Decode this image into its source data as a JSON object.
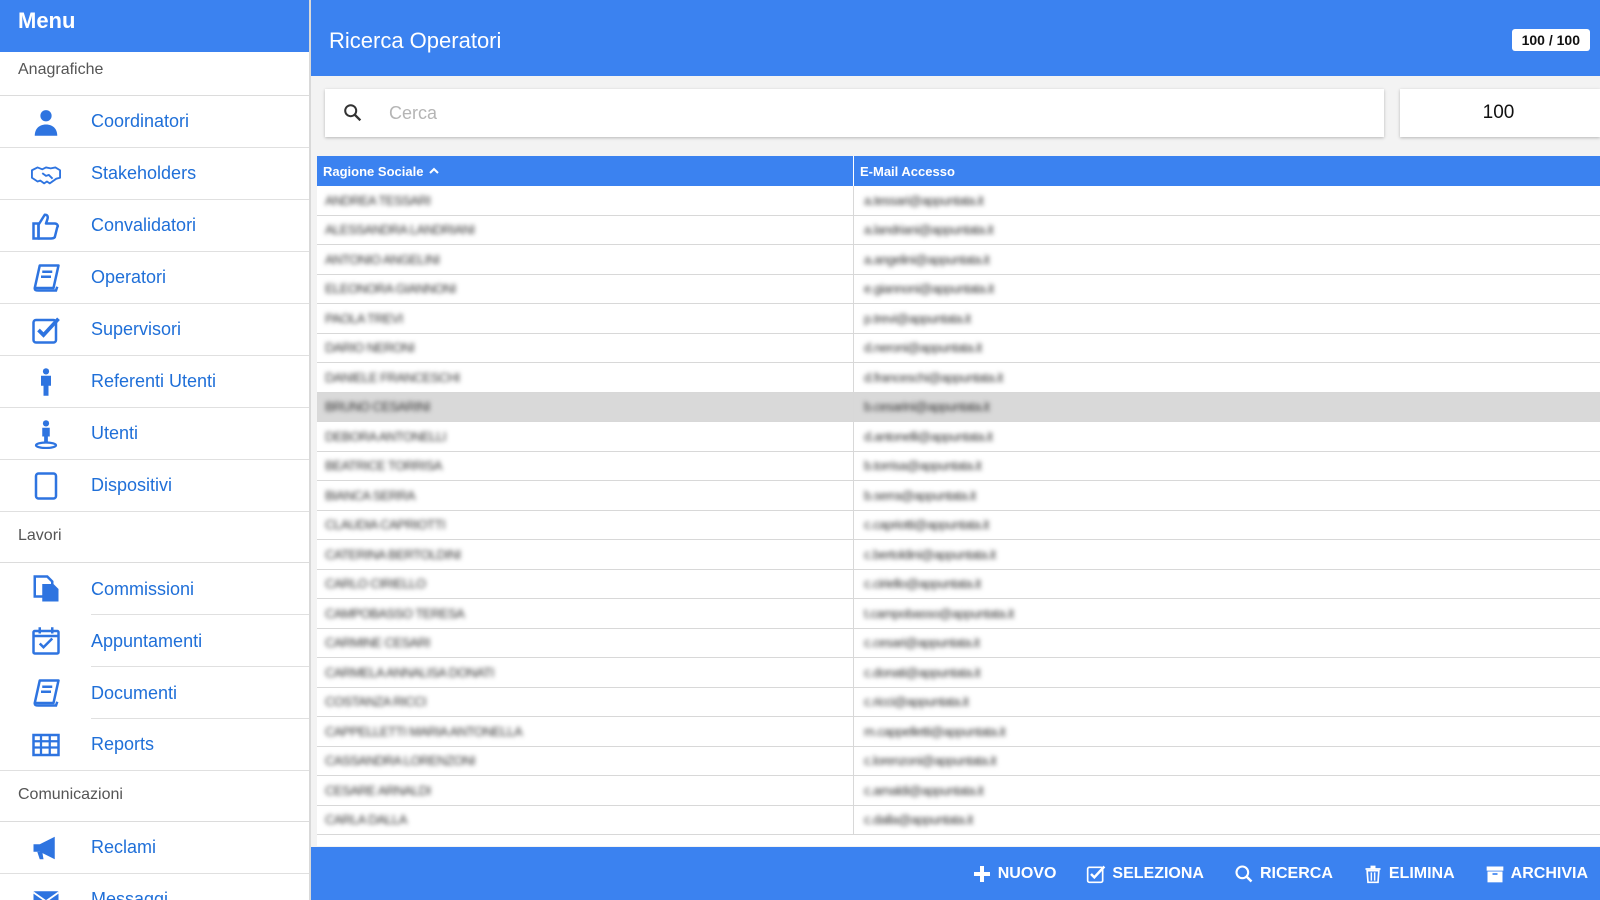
{
  "sidebar": {
    "title": "Menu",
    "sections": [
      {
        "title": "Anagrafiche",
        "items": [
          {
            "label": "Coordinatori",
            "icon": "user-icon"
          },
          {
            "label": "Stakeholders",
            "icon": "handshake-icon"
          },
          {
            "label": "Convalidatori",
            "icon": "thumbs-up-icon"
          },
          {
            "label": "Operatori",
            "icon": "book-icon"
          },
          {
            "label": "Supervisori",
            "icon": "check-square-icon"
          },
          {
            "label": "Referenti Utenti",
            "icon": "male-icon"
          },
          {
            "label": "Utenti",
            "icon": "street-view-icon"
          },
          {
            "label": "Dispositivi",
            "icon": "tablet-icon"
          }
        ]
      },
      {
        "title": "Lavori",
        "items": [
          {
            "label": "Commissioni",
            "icon": "files-icon"
          },
          {
            "label": "Appuntamenti",
            "icon": "calendar-check-icon"
          },
          {
            "label": "Documenti",
            "icon": "book-icon"
          },
          {
            "label": "Reports",
            "icon": "table-icon"
          }
        ]
      },
      {
        "title": "Comunicazioni",
        "items": [
          {
            "label": "Reclami",
            "icon": "megaphone-icon"
          },
          {
            "label": "Messaggi",
            "icon": "envelope-icon"
          }
        ]
      }
    ]
  },
  "header": {
    "title": "Ricerca Operatori",
    "counter": "100 / 100"
  },
  "search": {
    "placeholder": "Cerca",
    "value": "",
    "limit": "100"
  },
  "table": {
    "columns": [
      "Ragione Sociale",
      "E-Mail Accesso"
    ],
    "selected_row_index": 7,
    "rows": [
      [
        "ANDREA TESSARI",
        "a.tessari@appuntata.it"
      ],
      [
        "ALESSANDRA LANDRIANI",
        "a.landriani@appuntata.it"
      ],
      [
        "ANTONIO ANGELINI",
        "a.angelini@appuntata.it"
      ],
      [
        "ELEONORA GIANNONI",
        "e.giannoni@appuntata.it"
      ],
      [
        "PAOLA TREVI",
        "p.trevi@appuntata.it"
      ],
      [
        "DARIO NERONI",
        "d.neroni@appuntata.it"
      ],
      [
        "DANIELE FRANCESCHI",
        "d.franceschi@appuntata.it"
      ],
      [
        "BRUNO CESARINI",
        "b.cesarini@appuntata.it"
      ],
      [
        "DEBORA ANTONELLI",
        "d.antonelli@appuntata.it"
      ],
      [
        "BEATRICE TORRISA",
        "b.torrisa@appuntata.it"
      ],
      [
        "BIANCA SERRA",
        "b.serra@appuntata.it"
      ],
      [
        "CLAUDIA CAPRIOTTI",
        "c.capriotti@appuntata.it"
      ],
      [
        "CATERINA BERTOLDINI",
        "c.bertoldini@appuntata.it"
      ],
      [
        "CARLO CIRIELLO",
        "c.ciriello@appuntata.it"
      ],
      [
        "CAMPOBASSO TERESA",
        "t.campobasso@appuntata.it"
      ],
      [
        "CARMINE CESARI",
        "c.cesari@appuntata.it"
      ],
      [
        "CARMELA ANNALISA DONATI",
        "c.donati@appuntata.it"
      ],
      [
        "COSTANZA RICCI",
        "c.ricci@appuntata.it"
      ],
      [
        "CAPPELLETTI MARIA ANTONELLA",
        "m.cappelletti@appuntata.it"
      ],
      [
        "CASSANDRA LORENZONI",
        "c.lorenzoni@appuntata.it"
      ],
      [
        "CESARE ARNALDI",
        "c.arnaldi@appuntata.it"
      ],
      [
        "CARLA DALLA",
        "c.dalla@appuntata.it"
      ]
    ]
  },
  "footer": {
    "buttons": [
      {
        "label": "NUOVO",
        "icon": "plus-icon"
      },
      {
        "label": "SELEZIONA",
        "icon": "check-square-icon"
      },
      {
        "label": "RICERCA",
        "icon": "search-icon"
      },
      {
        "label": "ELIMINA",
        "icon": "trash-icon"
      },
      {
        "label": "ARCHIVIA",
        "icon": "archive-icon"
      }
    ]
  },
  "colors": {
    "primary": "#3b82f0",
    "link": "#1f6fd8",
    "icon": "#2e74e0",
    "selected_row": "#d9d9d9"
  }
}
